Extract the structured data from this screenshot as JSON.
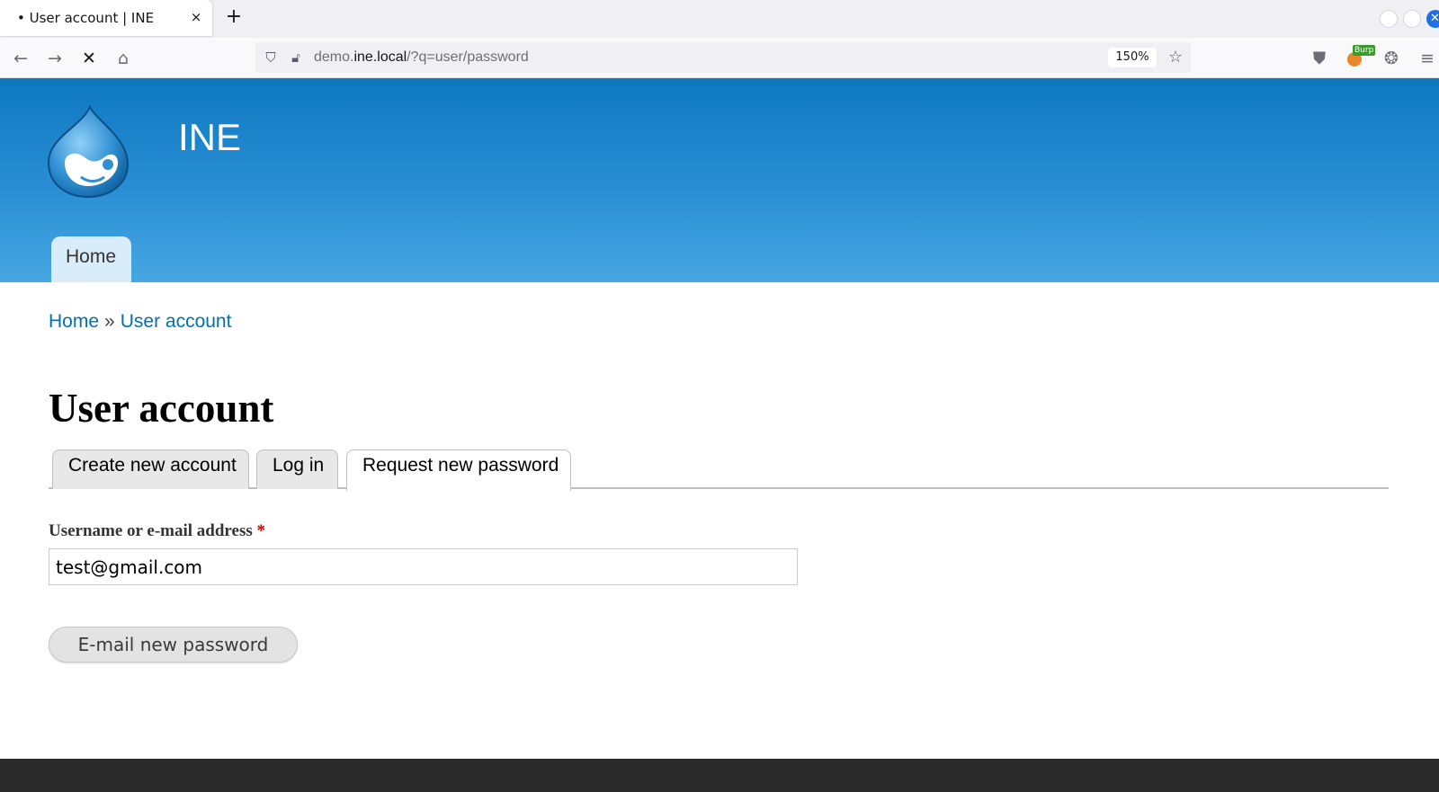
{
  "browser": {
    "tab_title": "• User account | INE",
    "tab_close": "×",
    "new_tab": "+",
    "url_host_prefix": "demo.",
    "url_host": "ine.local",
    "url_path": "/?q=user/password",
    "zoom": "150%",
    "burp_badge": "Burp"
  },
  "site": {
    "name": "INE",
    "primary_nav": [
      "Home"
    ]
  },
  "breadcrumb": {
    "items": [
      "Home",
      "User account"
    ],
    "separator": "»"
  },
  "page": {
    "title": "User account",
    "tabs": [
      {
        "label": "Create new account",
        "active": false
      },
      {
        "label": "Log in",
        "active": false
      },
      {
        "label": "Request new password",
        "active": true
      }
    ]
  },
  "form": {
    "username_label": "Username or e-mail address",
    "required_marker": "*",
    "username_value": "test@gmail.com",
    "submit_label": "E-mail new password"
  },
  "colors": {
    "header_top": "#0d78c0",
    "header_bottom": "#47a7e2",
    "link": "#0071b3",
    "required": "#cc0000",
    "footer": "#292929"
  }
}
